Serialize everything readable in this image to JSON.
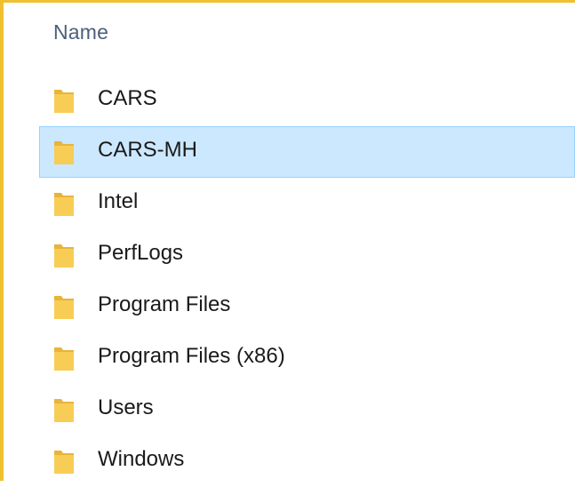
{
  "header": {
    "name_column": "Name"
  },
  "colors": {
    "accent_border": "#f0c030",
    "selection_fill": "#cce8ff",
    "selection_border": "#99d1ff",
    "folder": "#f5c542"
  },
  "folders": [
    {
      "name": "CARS",
      "icon": "folder-icon",
      "selected": false
    },
    {
      "name": "CARS-MH",
      "icon": "folder-icon",
      "selected": true
    },
    {
      "name": "Intel",
      "icon": "folder-icon",
      "selected": false
    },
    {
      "name": "PerfLogs",
      "icon": "folder-icon",
      "selected": false
    },
    {
      "name": "Program Files",
      "icon": "folder-icon",
      "selected": false
    },
    {
      "name": "Program Files (x86)",
      "icon": "folder-icon",
      "selected": false
    },
    {
      "name": "Users",
      "icon": "folder-icon",
      "selected": false
    },
    {
      "name": "Windows",
      "icon": "folder-icon",
      "selected": false
    }
  ]
}
